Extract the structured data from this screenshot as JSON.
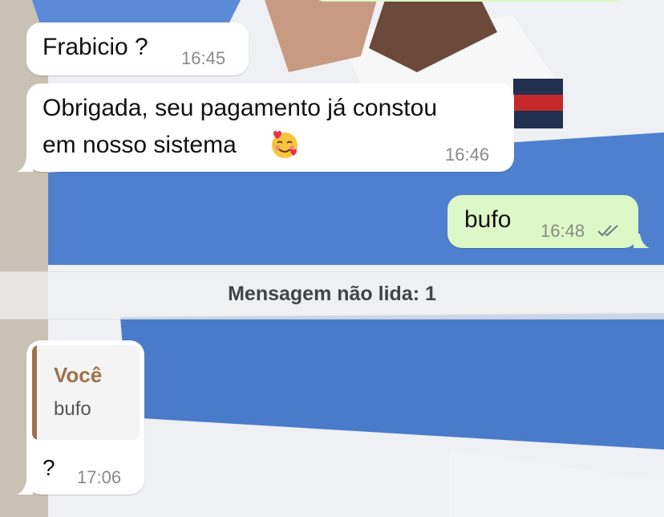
{
  "colors": {
    "incoming_bubble": "#ffffff",
    "outgoing_bubble": "#dcf8c6",
    "timestamp": "#8a8a8a",
    "quote_accent": "#a0714b",
    "read_ticks": "#6f7a80"
  },
  "messages": [
    {
      "direction": "incoming",
      "text": "Frabicio ?",
      "time": "16:45"
    },
    {
      "direction": "incoming",
      "text_line1": "Obrigada, seu pagamento já constou",
      "text_line2": "em nosso sistema",
      "emoji": "🥰",
      "time": "16:46"
    },
    {
      "direction": "outgoing",
      "text": "bufo",
      "time": "16:48",
      "status_icon": "double-check-icon"
    },
    {
      "direction": "incoming",
      "reply_to": {
        "author": "Você",
        "text": "bufo"
      },
      "text": "?",
      "time": "17:06"
    }
  ],
  "unread_divider": {
    "label": "Mensagem não lida: 1"
  }
}
